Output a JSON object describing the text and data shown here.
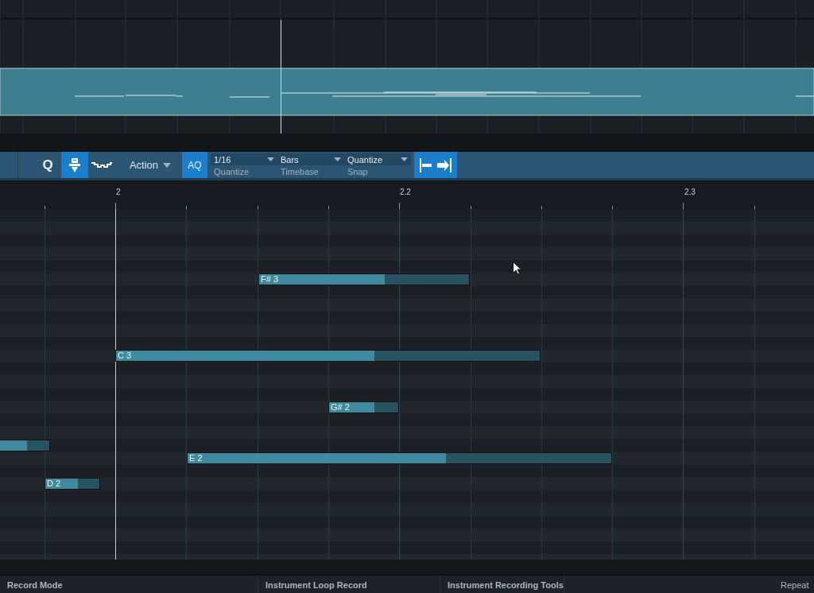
{
  "toolbar": {
    "buttons": [
      {
        "kind": "quantize",
        "label": "Q",
        "selected": false
      },
      {
        "kind": "icon",
        "selected": true
      },
      {
        "kind": "wave",
        "selected": false
      }
    ],
    "action": {
      "label": "Action"
    },
    "auto_quantize": {
      "label": "AQ",
      "selected": true
    },
    "dropdowns": [
      {
        "value": "1/16",
        "label": "Quantize"
      },
      {
        "value": "Bars",
        "label": "Timebase"
      },
      {
        "value": "Quantize",
        "label": "Snap"
      }
    ]
  },
  "ruler": {
    "labels": [
      "2",
      "2.2",
      "2.3"
    ]
  },
  "notes": [
    {
      "label": "F# 3",
      "level": 0.6
    },
    {
      "label": "C 3",
      "level": 0.61
    },
    {
      "label": "G# 2",
      "level": 0.65
    },
    {
      "level": 0.6
    },
    {
      "label": "E 2",
      "level": 0.61
    },
    {
      "label": "D 2",
      "level": 0.61
    }
  ],
  "status_bar": [
    "Record Mode",
    "Instrument Loop Record",
    "Instrument Recording Tools",
    "Repeat"
  ]
}
